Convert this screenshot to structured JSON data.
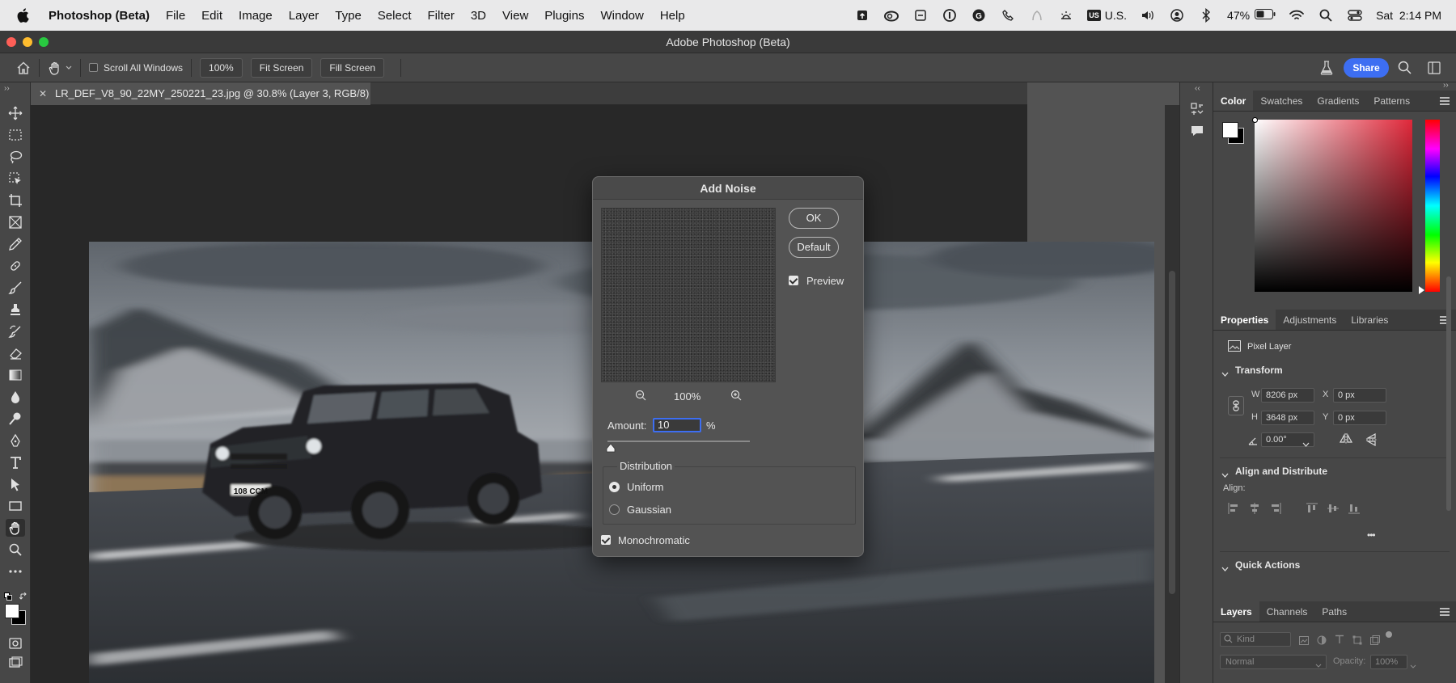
{
  "menubar": {
    "app_name": "Photoshop (Beta)",
    "items": [
      "File",
      "Edit",
      "Image",
      "Layer",
      "Type",
      "Select",
      "Filter",
      "3D",
      "View",
      "Plugins",
      "Window",
      "Help"
    ],
    "input_source": "U.S.",
    "battery": "47%",
    "clock": "Sat  2:14 PM"
  },
  "window": {
    "title": "Adobe Photoshop (Beta)"
  },
  "options_bar": {
    "scroll_all_windows": "Scroll All Windows",
    "zoom": "100%",
    "fit_screen": "Fit Screen",
    "fill_screen": "Fill Screen",
    "share": "Share"
  },
  "document": {
    "tab_title": "LR_DEF_V8_90_22MY_250221_23.jpg @ 30.8% (Layer 3, RGB/8) *",
    "plate_text": "108 CCM"
  },
  "dialog": {
    "title": "Add Noise",
    "ok": "OK",
    "default": "Default",
    "preview_label": "Preview",
    "preview_checked": true,
    "zoom": "100%",
    "amount_label": "Amount:",
    "amount_value": "10",
    "amount_unit": "%",
    "amount_fraction": 0.025,
    "distribution_label": "Distribution",
    "uniform": "Uniform",
    "gaussian": "Gaussian",
    "selected_distribution": "Uniform",
    "monochromatic": "Monochromatic",
    "monochromatic_checked": true
  },
  "color_panel": {
    "tabs": [
      "Color",
      "Swatches",
      "Gradients",
      "Patterns"
    ],
    "active_tab": "Color",
    "foreground": "#ffffff",
    "background": "#000000",
    "picker_hue": "#e0283a"
  },
  "properties_panel": {
    "tabs": [
      "Properties",
      "Adjustments",
      "Libraries"
    ],
    "layer_type": "Pixel Layer",
    "transform_label": "Transform",
    "w_label": "W",
    "w_value": "8206 px",
    "h_label": "H",
    "h_value": "3648 px",
    "x_label": "X",
    "x_value": "0 px",
    "y_label": "Y",
    "y_value": "0 px",
    "angle_value": "0.00°",
    "align_label": "Align and Distribute",
    "align_sub": "Align:",
    "more": "•••",
    "quick_actions": "Quick Actions"
  },
  "layers_panel": {
    "tabs": [
      "Layers",
      "Channels",
      "Paths"
    ],
    "kind_placeholder": "Kind",
    "blend_mode": "Normal",
    "opacity_label": "Opacity:",
    "opacity_value": "100%"
  }
}
